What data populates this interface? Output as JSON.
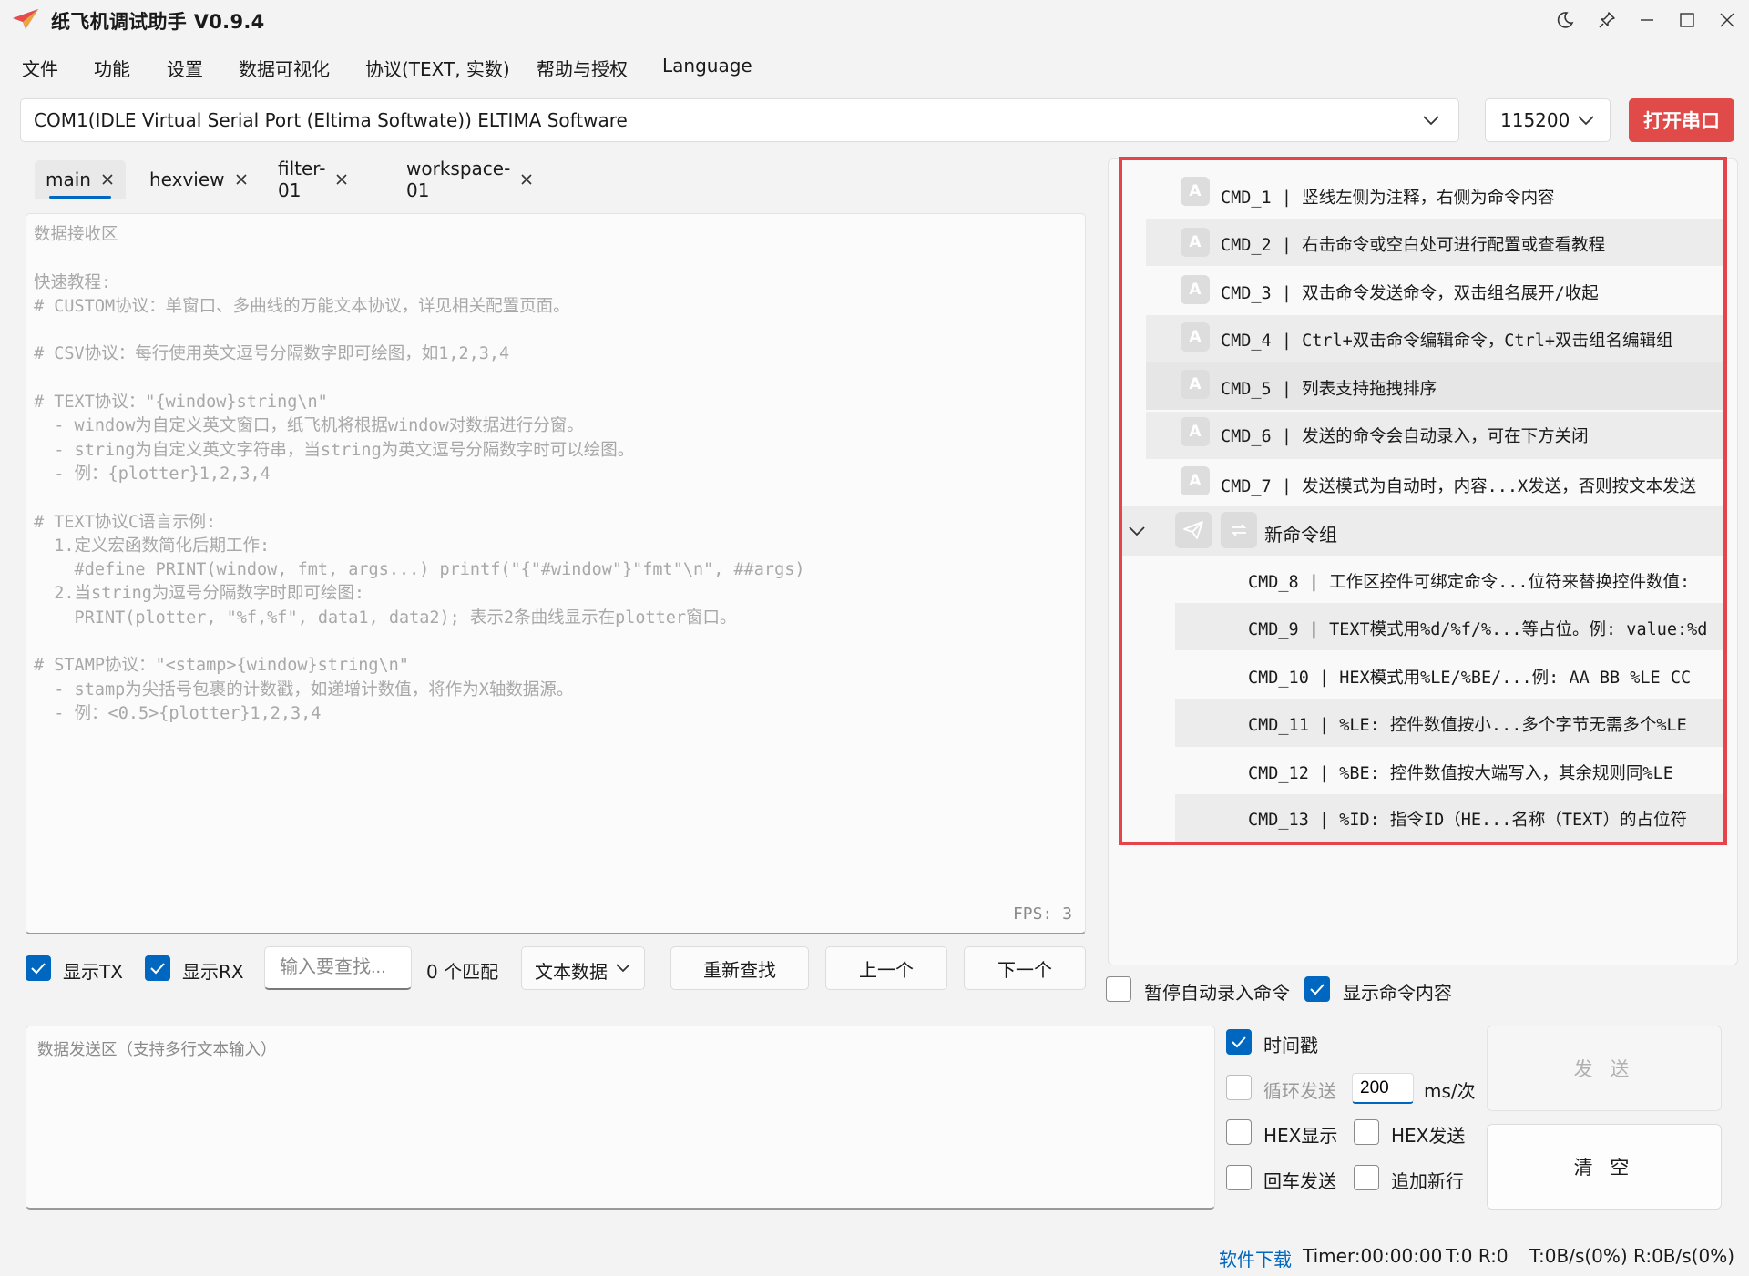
{
  "app": {
    "title": "纸飞机调试助手 V0.9.4",
    "accent_color": "#0067c0",
    "danger_color": "#e04a49",
    "highlight_color": "#e5454a"
  },
  "window_controls": [
    "moon-icon",
    "pin-icon",
    "minimize-icon",
    "maximize-icon",
    "close-icon"
  ],
  "menu": [
    "文件",
    "功能",
    "设置",
    "数据可视化",
    "协议(TEXT, 实数)",
    "帮助与授权",
    "Language"
  ],
  "port": {
    "selected": "COM1(IDLE  Virtual Serial Port (Eltima Softwate)) ELTIMA Software",
    "baud": "115200",
    "open_label": "打开串口"
  },
  "tabs": [
    "main",
    "hexview",
    "filter-01",
    "workspace-01"
  ],
  "receive": {
    "text": "数据接收区\n\n快速教程:\n# CUSTOM协议：单窗口、多曲线的万能文本协议，详见相关配置页面。\n\n# CSV协议：每行使用英文逗号分隔数字即可绘图，如1,2,3,4\n\n# TEXT协议：\"{window}string\\n\"\n  - window为自定义英文窗口，纸飞机将根据window对数据进行分窗。\n  - string为自定义英文字符串，当string为英文逗号分隔数字时可以绘图。\n  - 例：{plotter}1,2,3,4\n\n# TEXT协议C语言示例:\n  1.定义宏函数简化后期工作:\n    #define PRINT(window, fmt, args...) printf(\"{\"#window\"}\"fmt\"\\n\", ##args)\n  2.当string为逗号分隔数字时即可绘图:\n    PRINT(plotter, \"%f,%f\", data1, data2); 表示2条曲线显示在plotter窗口。\n\n# STAMP协议：\"<stamp>{window}string\\n\"\n  - stamp为尖括号包裹的计数戳，如递增计数值，将作为X轴数据源。\n  - 例：<0.5>{plotter}1,2,3,4",
    "fps": "FPS: 3"
  },
  "search_bar": {
    "show_tx": "显示TX",
    "show_rx": "显示RX",
    "show_tx_checked": true,
    "show_rx_checked": true,
    "placeholder": "输入要查找...",
    "match_count": "0 个匹配",
    "mode": "文本数据",
    "refind": "重新查找",
    "prev": "上一个",
    "next": "下一个"
  },
  "commands": {
    "badge": "A",
    "items": [
      "CMD_1  |  竖线左侧为注释，右侧为命令内容",
      "CMD_2  |  右击命令或空白处可进行配置或查看教程",
      "CMD_3  |  双击命令发送命令，双击组名展开/收起",
      "CMD_4  |  Ctrl+双击命令编辑命令，Ctrl+双击组名编辑组",
      "CMD_5  |  列表支持拖拽排序",
      "CMD_6  |  发送的命令会自动录入，可在下方关闭",
      "CMD_7  |  发送模式为自动时，内容...X发送，否则按文本发送"
    ],
    "group": {
      "name": "新命令组",
      "items": [
        "CMD_8  |  工作区控件可绑定命令...位符来替换控件数值:",
        "CMD_9  |  TEXT模式用%d/%f/%...等占位。例: value:%d",
        "CMD_10  |  HEX模式用%LE/%BE/...例: AA BB %LE CC",
        "CMD_11  |  %LE: 控件数值按小...多个字节无需多个%LE",
        "CMD_12  |  %BE: 控件数值按大端写入，其余规则同%LE",
        "CMD_13  |  %ID: 指令ID（HE...名称（TEXT）的占位符"
      ]
    },
    "pause_auto_record": "暂停自动录入命令",
    "pause_checked": false,
    "show_content": "显示命令内容",
    "show_content_checked": true
  },
  "send": {
    "placeholder": "数据发送区（支持多行文本输入）",
    "timestamp": "时间戳",
    "timestamp_checked": true,
    "loop_send": "循环发送",
    "loop_checked": false,
    "interval_value": "200",
    "interval_unit": "ms/次",
    "hex_display": "HEX显示",
    "hex_send": "HEX发送",
    "enter_send": "回车发送",
    "append_newline": "追加新行",
    "send_label": "发 送",
    "clear_label": "清 空"
  },
  "status": {
    "download": "软件下载",
    "timer": "Timer:00:00:00",
    "counts": "T:0  R:0",
    "rates": "T:0B/s(0%)  R:0B/s(0%)",
    "link_color": "#0067c0"
  }
}
